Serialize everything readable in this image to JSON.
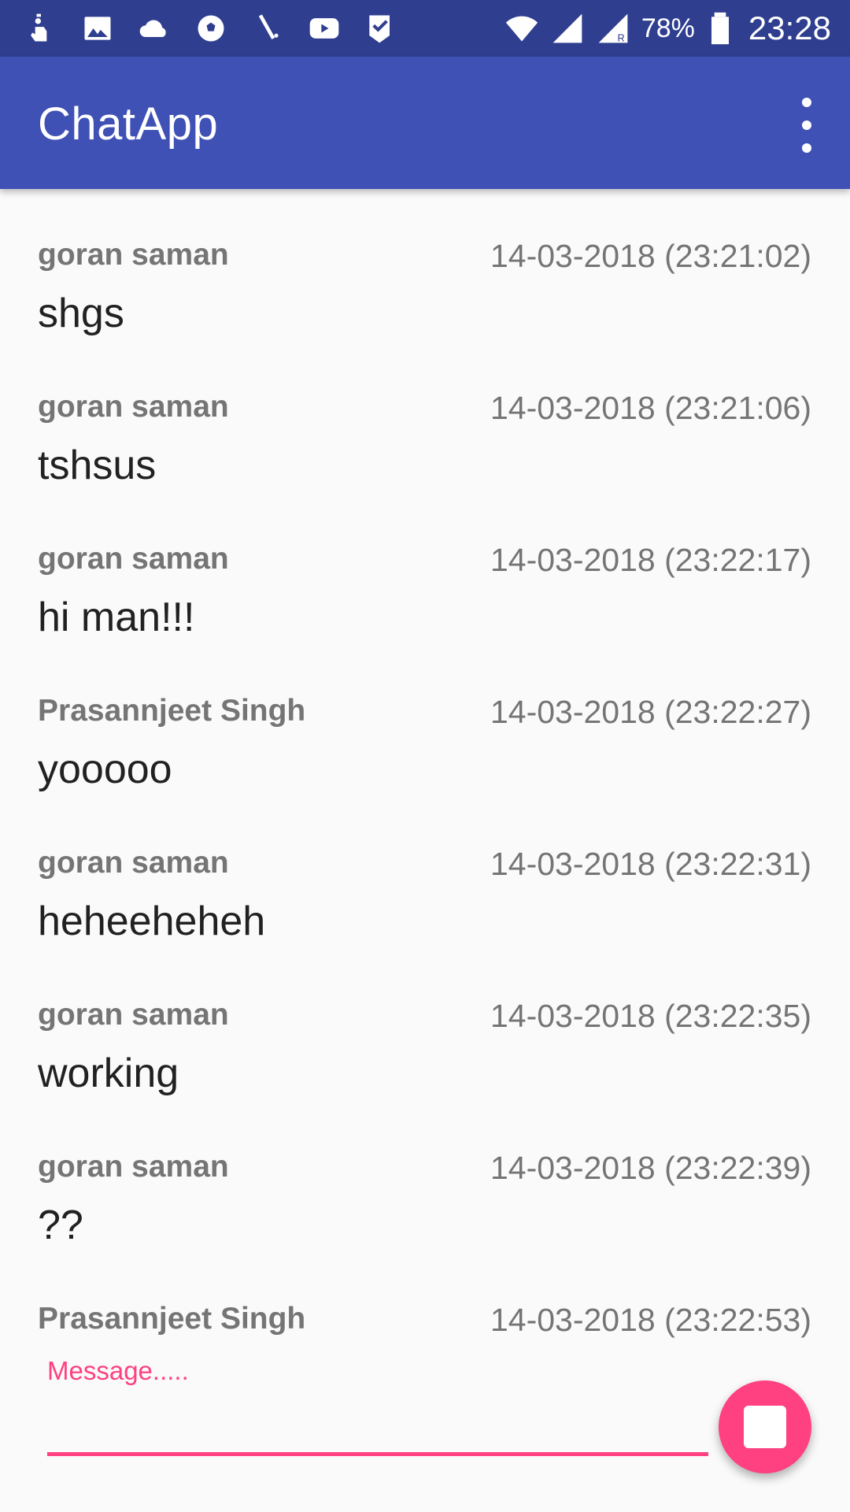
{
  "status_bar": {
    "left_icons": [
      "hand-icon",
      "image-icon",
      "cloud-icon",
      "soccer-ball-icon",
      "cricket-bat-icon",
      "youtube-icon",
      "check-badge-icon"
    ],
    "battery_percent": "78%",
    "time": "23:28"
  },
  "app_bar": {
    "title": "ChatApp",
    "menu_icon": "more-vert-icon"
  },
  "messages": [
    {
      "user": "goran saman",
      "time": "14-03-2018 (23:21:02)",
      "text": "shgs"
    },
    {
      "user": "goran saman",
      "time": "14-03-2018 (23:21:06)",
      "text": "tshsus"
    },
    {
      "user": "goran saman",
      "time": "14-03-2018 (23:22:17)",
      "text": "hi man!!!"
    },
    {
      "user": "Prasannjeet Singh",
      "time": "14-03-2018 (23:22:27)",
      "text": "yooooo"
    },
    {
      "user": "goran saman",
      "time": "14-03-2018 (23:22:31)",
      "text": "heheeheheh"
    },
    {
      "user": "goran saman",
      "time": "14-03-2018 (23:22:35)",
      "text": "working"
    },
    {
      "user": "goran saman",
      "time": "14-03-2018 (23:22:39)",
      "text": "??"
    },
    {
      "user": "Prasannjeet Singh",
      "time": "14-03-2018 (23:22:53)",
      "text": ""
    }
  ],
  "input": {
    "label": "Message.....",
    "value": ""
  },
  "colors": {
    "status_bar": "#2f3e8f",
    "primary": "#3f51b5",
    "accent": "#ff4081",
    "secondary_text": "#757575",
    "primary_text": "#212121"
  }
}
